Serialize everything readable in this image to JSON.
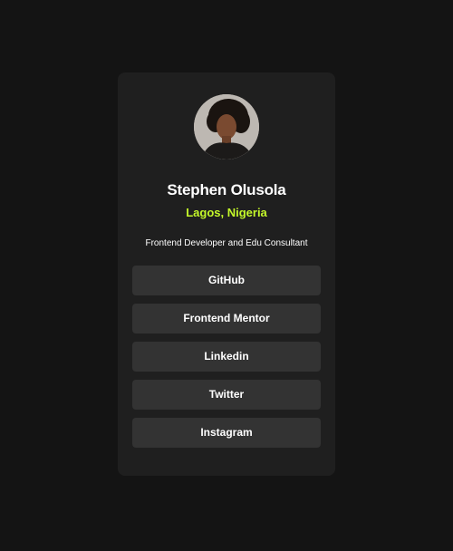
{
  "profile": {
    "name": "Stephen Olusola",
    "location": "Lagos, Nigeria",
    "bio": "Frontend Developer and Edu Consultant",
    "avatar_icon": "profile-photo"
  },
  "links": [
    {
      "label": "GitHub"
    },
    {
      "label": "Frontend Mentor"
    },
    {
      "label": "Linkedin"
    },
    {
      "label": "Twitter"
    },
    {
      "label": "Instagram"
    }
  ],
  "colors": {
    "page_bg": "#141414",
    "card_bg": "#1f1f1f",
    "button_bg": "#333333",
    "accent": "#c4f82a",
    "text": "#ffffff"
  }
}
